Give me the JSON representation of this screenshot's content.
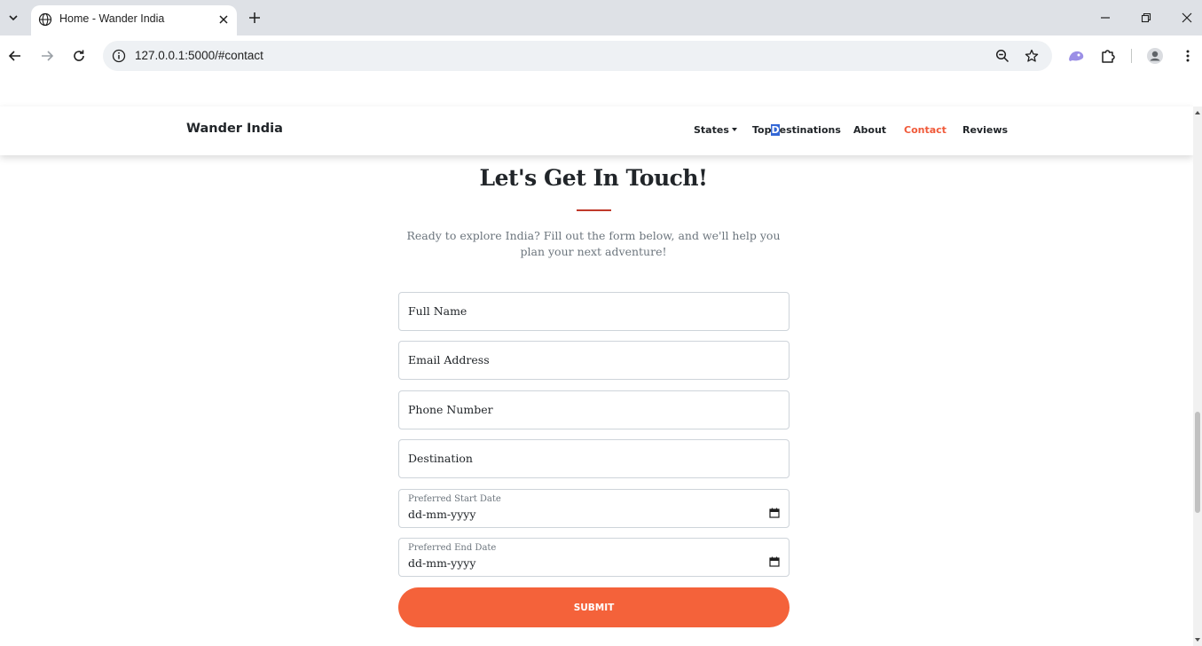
{
  "browser": {
    "tab_title": "Home - Wander India",
    "url": "127.0.0.1:5000/#contact"
  },
  "site": {
    "brand": "Wander India",
    "nav": {
      "states": "States",
      "top_destinations_part1": "Top",
      "top_destinations_selected": "D",
      "top_destinations_part2": "estinations",
      "about": "About",
      "contact": "Contact",
      "reviews": "Reviews"
    },
    "accent_color": "#f4623a"
  },
  "contact": {
    "heading": "Let's Get In Touch!",
    "subtitle": "Ready to explore India? Fill out the form below, and we'll help you plan your next adventure!",
    "fields": {
      "full_name": "Full Name",
      "email": "Email Address",
      "phone": "Phone Number",
      "destination": "Destination"
    },
    "start_date": {
      "label": "Preferred Start Date",
      "value": "dd-mm-yyyy"
    },
    "end_date": {
      "label": "Preferred End Date",
      "value": "dd-mm-yyyy"
    },
    "submit_label": "SUBMIT"
  }
}
